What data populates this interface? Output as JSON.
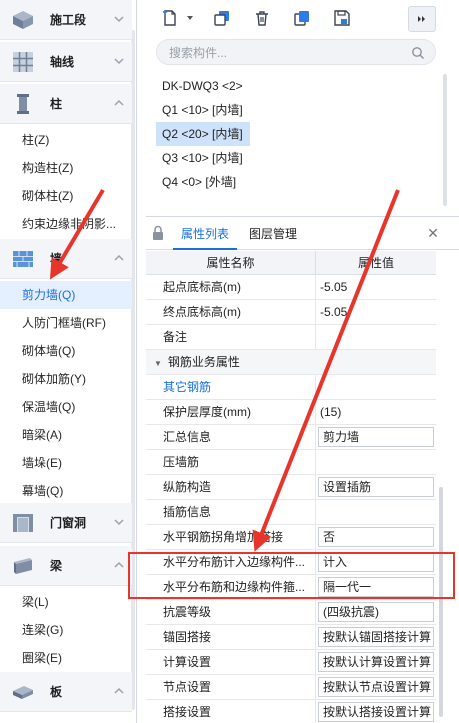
{
  "left_nav": {
    "categories": [
      {
        "label": "施工段",
        "icon": "construction-section-icon",
        "expanded": false
      },
      {
        "label": "轴线",
        "icon": "axis-grid-icon",
        "expanded": false
      },
      {
        "label": "柱",
        "icon": "column-icon",
        "expanded": true,
        "items": [
          "柱(Z)",
          "构造柱(Z)",
          "砌体柱(Z)",
          "约束边缘非阴影..."
        ]
      },
      {
        "label": "墙",
        "icon": "wall-icon",
        "expanded": true,
        "items": [
          "剪力墙(Q)",
          "人防门框墙(RF)",
          "砌体墙(Q)",
          "砌体加筋(Y)",
          "保温墙(Q)",
          "暗梁(A)",
          "墙垛(E)",
          "幕墙(Q)"
        ]
      },
      {
        "label": "门窗洞",
        "icon": "door-window-icon",
        "expanded": false
      },
      {
        "label": "梁",
        "icon": "beam-icon",
        "expanded": true,
        "items": [
          "梁(L)",
          "连梁(G)",
          "圈梁(E)"
        ]
      },
      {
        "label": "板",
        "icon": "slab-icon",
        "expanded": true
      }
    ],
    "active_item": "剪力墙(Q)"
  },
  "component_panel": {
    "toolbar": [
      "new-component-icon",
      "dropdown-arrow-icon",
      "copy-icon",
      "delete-icon",
      "duplicate-layer-icon",
      "save-icon"
    ],
    "search_placeholder": "搜索构件...",
    "components": [
      "DK-DWQ3 <2>",
      "Q1 <10> [内墙]",
      "Q2 <20> [内墙]",
      "Q3 <10> [内墙]",
      "Q4 <0> [外墙]"
    ],
    "selected": "Q2 <20> [内墙]"
  },
  "property_panel": {
    "tabs": [
      "属性列表",
      "图层管理"
    ],
    "active_tab": "属性列表",
    "header": {
      "name": "属性名称",
      "value": "属性值"
    },
    "rows_top": [
      {
        "name": "起点底标高(m)",
        "value": "-5.05"
      },
      {
        "name": "终点底标高(m)",
        "value": "-5.05"
      },
      {
        "name": "备注",
        "value": ""
      }
    ],
    "group": "钢筋业务属性",
    "rows": [
      {
        "name": "其它钢筋",
        "value": "",
        "link": true
      },
      {
        "name": "保护层厚度(mm)",
        "value": "(15)"
      },
      {
        "name": "汇总信息",
        "value": "剪力墙"
      },
      {
        "name": "压墙筋",
        "value": ""
      },
      {
        "name": "纵筋构造",
        "value": "设置插筋"
      },
      {
        "name": "插筋信息",
        "value": ""
      },
      {
        "name": "水平钢筋拐角增加搭接",
        "value": "否"
      },
      {
        "name": "水平分布筋计入边缘构件...",
        "value": "计入"
      },
      {
        "name": "水平分布筋和边缘构件箍...",
        "value": "隔一代一"
      },
      {
        "name": "抗震等级",
        "value": "(四级抗震)"
      },
      {
        "name": "锚固搭接",
        "value": "按默认锚固搭接计算"
      },
      {
        "name": "计算设置",
        "value": "按默认计算设置计算"
      },
      {
        "name": "节点设置",
        "value": "按默认节点设置计算"
      },
      {
        "name": "搭接设置",
        "value": "按默认搭接设置计算"
      }
    ]
  },
  "annotation": {
    "arrow_color": "#e8352b",
    "highlight_color": "#e8352b"
  }
}
